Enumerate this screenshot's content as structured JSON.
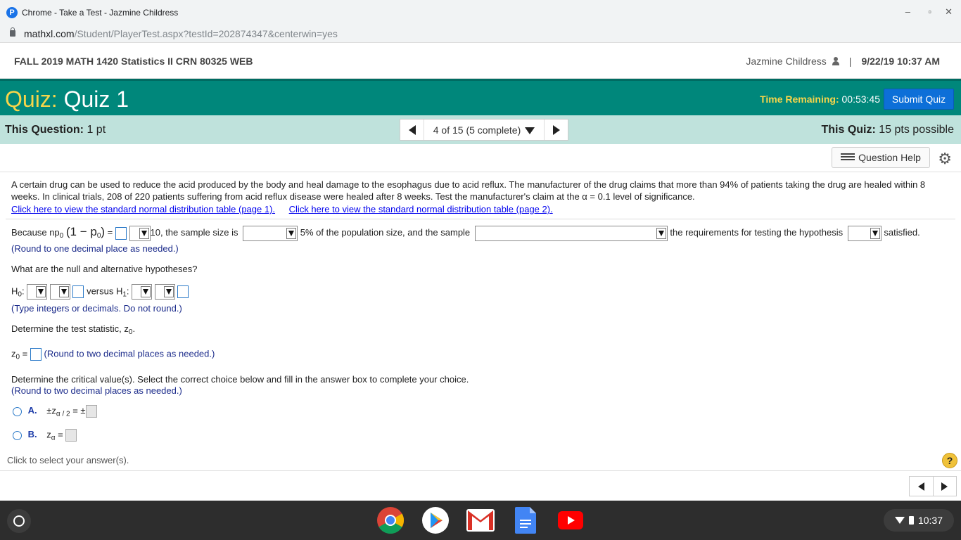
{
  "browser": {
    "window_title": "Chrome - Take a Test - Jazmine Childress",
    "url_host": "mathxl.com",
    "url_path": "/Student/PlayerTest.aspx?testId=202874347&centerwin=yes",
    "minimize": "–",
    "restore": "▫",
    "close": "✕"
  },
  "header": {
    "course": "FALL 2019 MATH 1420 Statistics II CRN 80325 WEB",
    "user": "Jazmine Childress",
    "separator": "|",
    "datetime": "9/22/19 10:37 AM"
  },
  "quiz": {
    "label": "Quiz:",
    "name": "Quiz 1",
    "time_label": "Time Remaining:",
    "time_value": "00:53:45",
    "submit_label": "Submit Quiz"
  },
  "question_bar": {
    "this_question_label": "This Question:",
    "this_question_value": "1 pt",
    "pager_label": "4 of 15 (5 complete)",
    "this_quiz_label": "This Quiz:",
    "this_quiz_value": "15 pts possible"
  },
  "help": {
    "question_help_label": "Question Help"
  },
  "problem": {
    "text": "A certain drug can be used to reduce the acid produced by the body and heal damage to the esophagus due to acid reflux. The manufacturer of the drug claims that more than 94% of patients taking the drug are healed within 8 weeks. In clinical trials, 208 of 220 patients suffering from acid reflux disease were healed after 8 weeks. Test the manufacturer's claim at the α = 0.1 level of significance.",
    "link1": "Click here to view the standard normal distribution table (page 1).",
    "link2": "Click here to view the standard normal distribution table (page 2)."
  },
  "parts": {
    "because_prefix": "Because np",
    "because_mid": "(1 − p",
    "because_close": ")",
    "equals": "=",
    "ten_text": "10, the sample size is",
    "pct_text": "5% of the population size, and the sample",
    "req_text": "the requirements for testing the hypothesis",
    "satisfied": "satisfied.",
    "hint_round1": "(Round to one decimal place as needed.)",
    "hyp_question": "What are the null and alternative hypotheses?",
    "h0_label": "H",
    "h0_sub": "0",
    "versus": "versus H",
    "h1_sub": "1",
    "hint_integers": "(Type integers or decimals. Do not round.)",
    "stat_question": "Determine the test statistic, z",
    "z0_label": "z",
    "z0_sub": "0",
    "hint_round2_inline": "(Round to two decimal places as needed.)",
    "crit_question": "Determine the critical value(s). Select the correct choice below and fill in the answer box to complete your choice.",
    "hint_round2": "(Round to two decimal places as needed.)",
    "choice_a_letter": "A.",
    "choice_a_expr": "±z",
    "choice_a_sub": "α / 2",
    "choice_a_eq": "= ±",
    "choice_b_letter": "B.",
    "choice_b_expr": "z",
    "choice_b_sub": "α",
    "choice_b_eq": "="
  },
  "footer": {
    "click_select": "Click to select your answer(s).",
    "help_q": "?"
  },
  "taskbar": {
    "time": "10:37",
    "apps": [
      "chrome-icon",
      "play-store-icon",
      "gmail-icon",
      "docs-icon",
      "youtube-icon"
    ]
  }
}
